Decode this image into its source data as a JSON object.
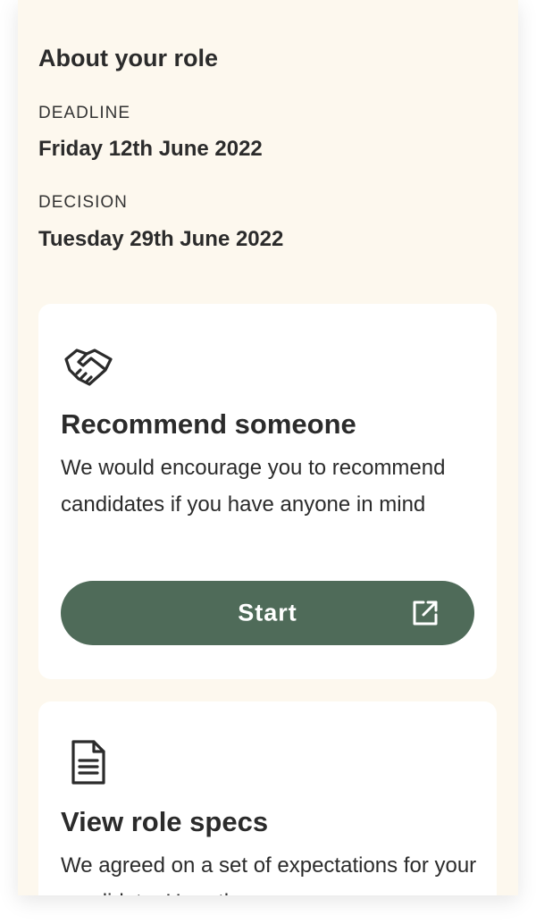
{
  "about": {
    "title": "About your role",
    "deadline_label": "DEADLINE",
    "deadline_value": "Friday 12th June 2022",
    "decision_label": "DECISION",
    "decision_value": "Tuesday 29th June 2022"
  },
  "recommend_card": {
    "icon": "handshake-icon",
    "title": "Recommend someone",
    "description": "We would encourage you to recommend candidates if you have anyone in mind",
    "button_label": "Start",
    "button_icon": "external-link-icon"
  },
  "specs_card": {
    "icon": "document-icon",
    "title": "View role specs",
    "description": "We agreed on a set of expectations for your candidate. Here they are."
  },
  "colors": {
    "page_background": "#fdf8ee",
    "card_background": "#ffffff",
    "button_background": "#4f6b59",
    "text": "#2b2b2b"
  }
}
